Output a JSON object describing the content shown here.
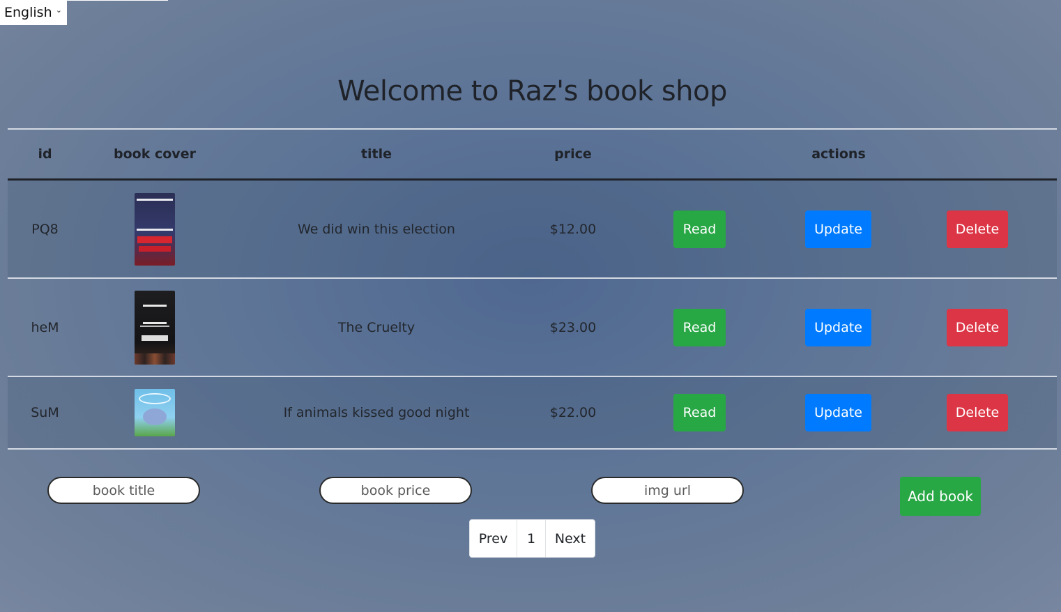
{
  "language_select": {
    "value": "English"
  },
  "page_title": "Welcome to Raz's book shop",
  "table": {
    "headers": {
      "id": "id",
      "cover": "book cover",
      "title": "title",
      "price": "price",
      "actions": "actions"
    },
    "rows": [
      {
        "id": "PQ8",
        "title": "We did win this election",
        "price": "$12.00",
        "read": "Read",
        "update": "Update",
        "delete": "Delete"
      },
      {
        "id": "heM",
        "title": "The Cruelty",
        "price": "$23.00",
        "read": "Read",
        "update": "Update",
        "delete": "Delete"
      },
      {
        "id": "SuM",
        "title": "If animals kissed good night",
        "price": "$22.00",
        "read": "Read",
        "update": "Update",
        "delete": "Delete"
      }
    ]
  },
  "add_form": {
    "title_placeholder": "book title",
    "price_placeholder": "book price",
    "img_placeholder": "img url",
    "add_label": "Add book"
  },
  "pagination": {
    "prev": "Prev",
    "page": "1",
    "next": "Next"
  },
  "colors": {
    "read": "#28a745",
    "update": "#007bff",
    "delete": "#dc3545"
  }
}
